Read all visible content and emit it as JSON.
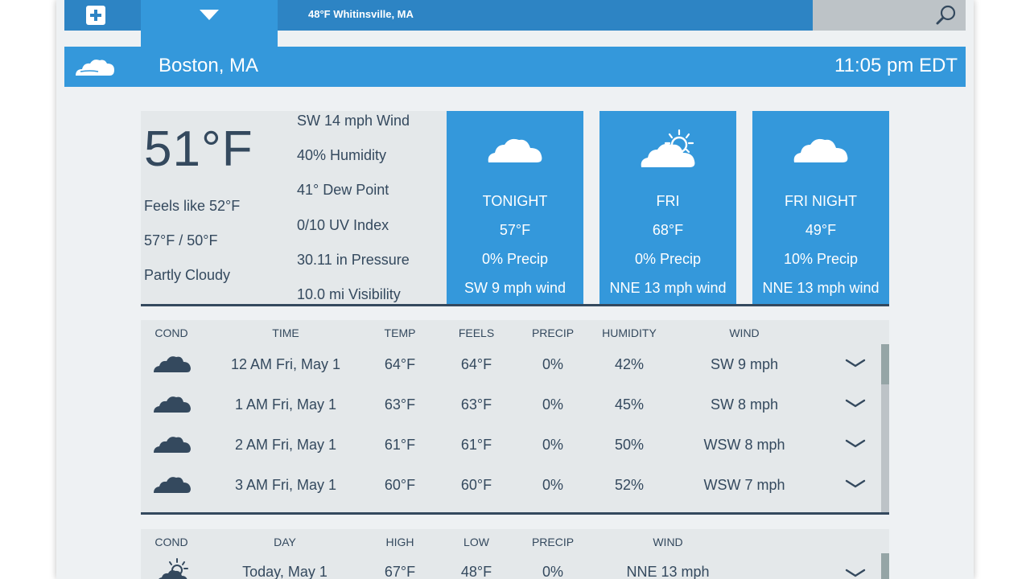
{
  "topbar": {
    "location_strip": "48°F Whitinsville, MA"
  },
  "location": {
    "city": "Boston, MA",
    "time": "11:05 pm EDT"
  },
  "current": {
    "temp": "51°F",
    "feels_like": "Feels like 52°F",
    "high_low": "57°F / 50°F",
    "condition": "Partly Cloudy",
    "details": [
      "SW 14 mph Wind",
      "40% Humidity",
      "41° Dew Point",
      "0/10 UV Index",
      "30.11 in Pressure",
      "10.0 mi Visibility"
    ]
  },
  "forecast_cards": [
    {
      "icon": "cloud-icon",
      "period": "TONIGHT",
      "temp": "57°F",
      "precip": "0% Precip",
      "wind": "SW 9 mph wind"
    },
    {
      "icon": "partly-sunny-icon",
      "period": "FRI",
      "temp": "68°F",
      "precip": "0% Precip",
      "wind": "NNE 13 mph wind"
    },
    {
      "icon": "cloud-icon",
      "period": "FRI NIGHT",
      "temp": "49°F",
      "precip": "10% Precip",
      "wind": "NNE 13 mph wind"
    }
  ],
  "hourly": {
    "headers": [
      "COND",
      "TIME",
      "TEMP",
      "FEELS",
      "PRECIP",
      "HUMIDITY",
      "WIND"
    ],
    "rows": [
      {
        "icon": "cloud-icon",
        "time": "12 AM Fri, May 1",
        "temp": "64°F",
        "feels": "64°F",
        "precip": "0%",
        "humidity": "42%",
        "wind": "SW 9 mph"
      },
      {
        "icon": "cloud-icon",
        "time": "1 AM Fri, May 1",
        "temp": "63°F",
        "feels": "63°F",
        "precip": "0%",
        "humidity": "45%",
        "wind": "SW 8 mph"
      },
      {
        "icon": "cloud-icon",
        "time": "2 AM Fri, May 1",
        "temp": "61°F",
        "feels": "61°F",
        "precip": "0%",
        "humidity": "50%",
        "wind": "WSW 8 mph"
      },
      {
        "icon": "cloud-icon",
        "time": "3 AM Fri, May 1",
        "temp": "60°F",
        "feels": "60°F",
        "precip": "0%",
        "humidity": "52%",
        "wind": "WSW 7 mph"
      }
    ]
  },
  "daily": {
    "headers": [
      "COND",
      "DAY",
      "HIGH",
      "LOW",
      "PRECIP",
      "WIND"
    ],
    "rows": [
      {
        "icon": "partly-sunny-icon",
        "day": "Today, May 1",
        "high": "67°F",
        "low": "48°F",
        "precip": "0%",
        "wind": "NNE 13 mph"
      }
    ]
  },
  "colors": {
    "accent": "#3498db",
    "dark_accent": "#2d84c4",
    "text_dark": "#34495e",
    "panel": "#e4e8ea",
    "background": "#eef1f3"
  }
}
